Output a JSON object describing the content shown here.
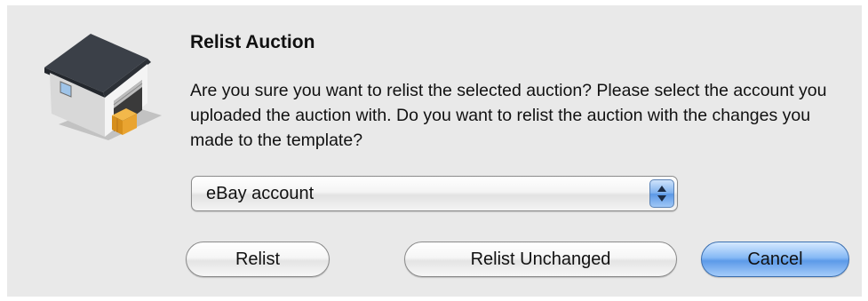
{
  "dialog": {
    "title": "Relist Auction",
    "message": "Are you sure you want to relist the selected auction? Please select the account you uploaded the auction with. Do you want to relist the auction with the changes you made to the template?",
    "icon": "warehouse-icon"
  },
  "account_select": {
    "selected": "eBay account"
  },
  "buttons": {
    "relist": "Relist",
    "relist_unchanged": "Relist Unchanged",
    "cancel": "Cancel"
  },
  "colors": {
    "dialog_bg": "#e9e9e9",
    "default_button": "#5c9ae8"
  }
}
